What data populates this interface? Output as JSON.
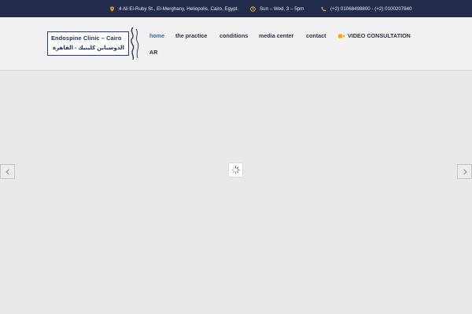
{
  "topbar": {
    "address": "4 Ali El-Ruby St., El-Merghany, Heliopolis, Cairo, Egypt.",
    "hours": "Sun – Wed, 3 – 5pm",
    "phones": "(+2) 01068498800 - (+2) 0100207840",
    "icon_color": "#f5a623",
    "background": "#232c4b",
    "icons": [
      "location-pin-icon",
      "clock-icon",
      "phone-icon"
    ]
  },
  "logo": {
    "text_en": "Endospine Clinic – Cairo",
    "text_ar": "الدوسباين كلينيك - القاهرة"
  },
  "nav": {
    "items": [
      {
        "label": "home",
        "active": true
      },
      {
        "label": "the practice",
        "active": false
      },
      {
        "label": "conditions",
        "active": false
      },
      {
        "label": "media center",
        "active": false
      },
      {
        "label": "contact",
        "active": false
      },
      {
        "label": "VIDEO CONSULTATION",
        "active": false,
        "icon": "video-camera-icon"
      },
      {
        "label": "AR",
        "active": false
      }
    ],
    "active_color": "#2f6db5",
    "video_icon_color": "#f5a623"
  },
  "slider": {
    "prev_icon": "chevron-left-icon",
    "next_icon": "chevron-right-icon",
    "loader_icon": "spinner-icon"
  }
}
